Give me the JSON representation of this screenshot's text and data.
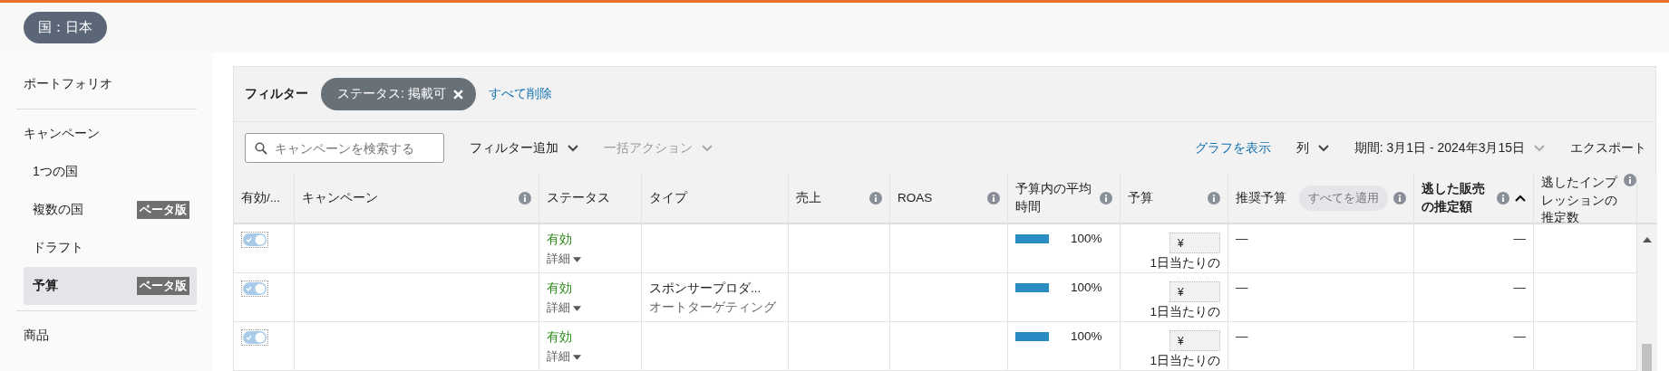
{
  "country_chip": "国：日本",
  "sidebar": {
    "items": [
      {
        "label": "ポートフォリオ",
        "selected": false
      },
      {
        "label": "キャンペーン",
        "selected": false,
        "children": [
          {
            "label": "1つの国",
            "selected": false
          },
          {
            "label": "複数の国",
            "badge": "ベータ版",
            "selected": false
          },
          {
            "label": "ドラフト",
            "selected": false
          },
          {
            "label": "予算",
            "badge": "ベータ版",
            "selected": true
          }
        ]
      },
      {
        "label": "商品",
        "selected": false
      }
    ]
  },
  "filters": {
    "label": "フィルター",
    "chips": [
      {
        "label": "ステータス: 掲載可"
      }
    ],
    "clear_all": "すべて削除"
  },
  "toolbar": {
    "search": {
      "placeholder": "キャンペーンを検索する"
    },
    "add_filter": "フィルター追加",
    "bulk_actions": {
      "label": "一括アクション",
      "disabled": true
    },
    "show_chart": "グラフを表示",
    "columns": "列",
    "date_range": "期間: 3月1日 - 2024年3月15日",
    "export": "エクスポート"
  },
  "table": {
    "columns": [
      {
        "label": "有効/...",
        "info": false,
        "sorted": false
      },
      {
        "label": "キャンペーン",
        "info": true,
        "sorted": false
      },
      {
        "label": "ステータス",
        "info": false,
        "sorted": false
      },
      {
        "label": "タイプ",
        "info": false,
        "sorted": false
      },
      {
        "label": "売上",
        "info": true,
        "sorted": false
      },
      {
        "label": "ROAS",
        "info": true,
        "sorted": false
      },
      {
        "label": "予算内の平均時間",
        "info": true,
        "sorted": false
      },
      {
        "label": "予算",
        "info": true,
        "sorted": false
      },
      {
        "label": "推奨予算",
        "info": true,
        "sorted": false,
        "action": "すべてを適用"
      },
      {
        "label": "逃した販売の推定額",
        "info": true,
        "sorted": true
      },
      {
        "label": "逃したインプレッションの推定数",
        "info": true,
        "sorted": false
      }
    ],
    "rows": [
      {
        "on": true,
        "status": "有効",
        "details": "詳細",
        "time_in_budget": {
          "level": 1,
          "reading": "100%"
        },
        "budget": {
          "currency": "¥",
          "period": "1日当たりの"
        },
        "suggested_budget": "—",
        "missed_sales": "—"
      },
      {
        "on": true,
        "status": "有効",
        "details": "詳細",
        "type": "スポンサープロダ...",
        "targeting": "オートターゲティング",
        "time_in_budget": {
          "level": 1,
          "reading": "100%"
        },
        "budget": {
          "currency": "¥",
          "period": "1日当たりの"
        },
        "suggested_budget": "—",
        "missed_sales": "—"
      },
      {
        "on": true,
        "status": "有効",
        "details": "詳細",
        "time_in_budget": {
          "level": 1,
          "reading": "100%"
        },
        "budget": {
          "currency": "¥",
          "period": "1日当たりの"
        },
        "suggested_budget": "—",
        "missed_sales": "—"
      }
    ]
  }
}
